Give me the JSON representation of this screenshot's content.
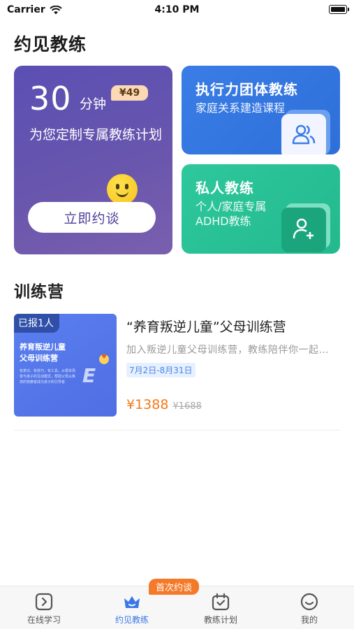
{
  "status_bar": {
    "carrier": "Carrier",
    "time": "4:10 PM"
  },
  "page": {
    "title": "约见教练"
  },
  "main_card": {
    "minutes": "30",
    "unit": "分钟",
    "price_tag": "¥49",
    "desc": "为您定制专属教练计划",
    "cta": "立即约谈"
  },
  "team_card": {
    "title": "执行力团体教练",
    "subtitle": "家庭关系建造课程",
    "icon": "group-icon"
  },
  "private_card": {
    "title": "私人教练",
    "subtitle": "个人/家庭专属ADHD教练",
    "icon": "add-user-icon"
  },
  "camp_section": {
    "title": "训练营",
    "items": [
      {
        "enrolled": "已报1人",
        "thumb_title_1": "养育叛逆儿童",
        "thumb_title_2": "父母训练营",
        "thumb_small": "有意识、有技巧、有工具，从根本改变与孩子的互动模式，帮助父母从焦虑的管教者成为孩子的引导者",
        "title": "“养育叛逆儿童”父母训练营",
        "desc": "加入叛逆儿童父母训练营，教练陪伴你一起…",
        "date": "7月2日-8月31日",
        "price": "¥1388",
        "original_price": "¥1688"
      }
    ]
  },
  "tab_bar": {
    "badge": "首次约谈",
    "tabs": [
      {
        "label": "在线学习",
        "icon": "play-icon",
        "active": false
      },
      {
        "label": "约见教练",
        "icon": "crown-icon",
        "active": true
      },
      {
        "label": "教练计划",
        "icon": "calendar-icon",
        "active": false
      },
      {
        "label": "我的",
        "icon": "smile-icon",
        "active": false
      }
    ]
  },
  "colors": {
    "main_card": "#5a4fb3",
    "team_card": "#3a7de6",
    "private_card": "#2ec89c",
    "price": "#f27a1a",
    "active_tab": "#3a78e6",
    "badge": "#f47a2a"
  }
}
